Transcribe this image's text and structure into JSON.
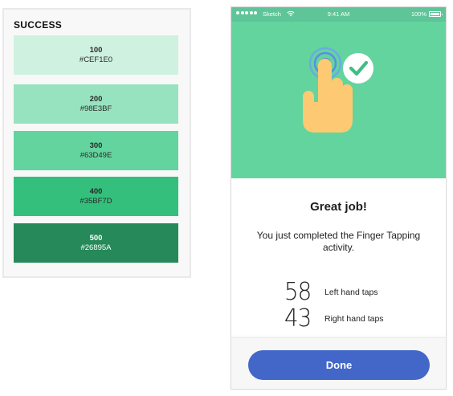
{
  "palette": {
    "title": "SUCCESS",
    "swatches": [
      {
        "level": "100",
        "hex": "#CEF1E0"
      },
      {
        "level": "200",
        "hex": "#98E3BF"
      },
      {
        "level": "300",
        "hex": "#63D49E"
      },
      {
        "level": "400",
        "hex": "#35BF7D"
      },
      {
        "level": "500",
        "hex": "#26895A"
      }
    ]
  },
  "phone": {
    "statusbar": {
      "carrier": "Sketch",
      "time": "9:41 AM",
      "battery": "100%"
    },
    "hero": {
      "icon": "finger-tap-check-icon",
      "background": "#63D49E"
    },
    "heading": "Great job!",
    "message": "You just completed the Finger Tapping activity.",
    "stats": [
      {
        "value": "58",
        "label": "Left hand taps"
      },
      {
        "value": "43",
        "label": "Right hand taps"
      }
    ],
    "done_label": "Done",
    "accent": "#4367C9"
  }
}
